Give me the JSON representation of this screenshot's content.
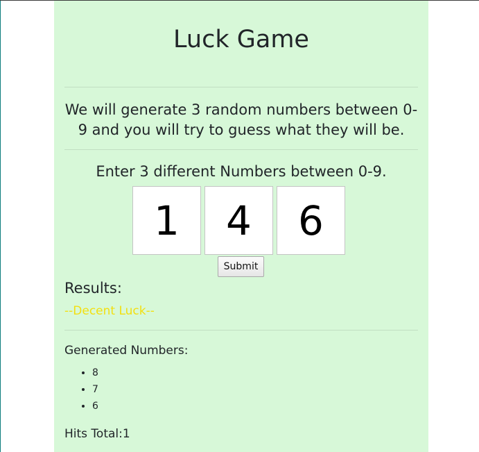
{
  "page": {
    "title": "Luck Game",
    "intro": "We will generate 3 random numbers between 0-9 and you will try to guess what they will be.",
    "instruction": "Enter 3 different Numbers between 0-9."
  },
  "guess_form": {
    "inputs": [
      {
        "value": "1"
      },
      {
        "value": "4"
      },
      {
        "value": "6"
      }
    ],
    "submit_label": "Submit"
  },
  "results": {
    "heading": "Results:",
    "luck_message": "--Decent Luck--",
    "luck_color": "#f3df0f",
    "generated_heading": "Generated Numbers:",
    "generated_numbers": [
      "8",
      "7",
      "6"
    ],
    "hits_text": "Hits Total:1"
  },
  "colors": {
    "card_background": "#d7f8d8",
    "page_background": "#ffffff",
    "text": "#212529"
  }
}
